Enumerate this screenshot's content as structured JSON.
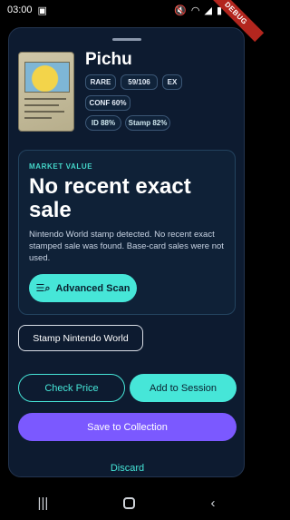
{
  "status_bar": {
    "time": "03:00",
    "debug_label": "DEBUG"
  },
  "card": {
    "name": "Pichu",
    "rarity": "RARE",
    "number": "59/106",
    "set": "EX",
    "confidence": "CONF 60%",
    "id_score": "ID 88%",
    "stamp_score": "Stamp 82%"
  },
  "market": {
    "label": "MARKET VALUE",
    "headline": "No recent exact sale",
    "description": "Nintendo World stamp detected. No recent exact stamped sale was found. Base-card sales were not used.",
    "advanced_scan_label": "Advanced Scan"
  },
  "actions": {
    "stamp_label": "Stamp Nintendo World",
    "check_price_label": "Check Price",
    "add_session_label": "Add to Session",
    "save_label": "Save to Collection",
    "discard_label": "Discard"
  },
  "colors": {
    "accent_teal": "#46e6d8",
    "accent_purple": "#7b59ff",
    "sheet_bg": "#0d1b30"
  }
}
